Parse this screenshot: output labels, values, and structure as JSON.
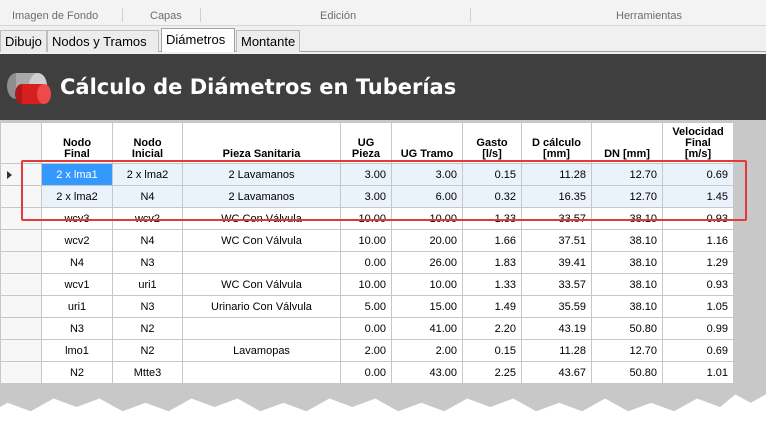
{
  "ribbon": {
    "groups": [
      "Imagen de Fondo",
      "Capas",
      "Edición",
      "Herramientas"
    ]
  },
  "tabs": [
    {
      "label": "Dibujo",
      "active": false
    },
    {
      "label": "Nodos y Tramos",
      "active": false
    },
    {
      "label": "Diámetros",
      "active": true
    },
    {
      "label": "Montante",
      "active": false
    }
  ],
  "header": {
    "title": "Cálculo de Diámetros en Tuberías",
    "icon": "pipe-icon",
    "colors": {
      "band": "#3f3f3f",
      "pipe_red": "#d62020",
      "pipe_gray": "#9a9a9a"
    }
  },
  "grid": {
    "columns": [
      [
        "Nodo",
        "Final"
      ],
      [
        "Nodo",
        "Inicial"
      ],
      [
        "Pieza Sanitaria"
      ],
      [
        "UG",
        "Pieza"
      ],
      [
        "UG Tramo"
      ],
      [
        "Gasto",
        "[l/s]"
      ],
      [
        "D cálculo",
        "[mm]"
      ],
      [
        "DN [mm]"
      ],
      [
        "Velocidad",
        "Final",
        "[m/s]"
      ]
    ],
    "rows": [
      [
        "2 x lma1",
        "2 x lma2",
        "2 Lavamanos",
        "3.00",
        "3.00",
        "0.15",
        "11.28",
        "12.70",
        "0.69"
      ],
      [
        "2 x lma2",
        "N4",
        "2 Lavamanos",
        "3.00",
        "6.00",
        "0.32",
        "16.35",
        "12.70",
        "1.45"
      ],
      [
        "wcv3",
        "wcv2",
        "WC Con Válvula",
        "10.00",
        "10.00",
        "1.33",
        "33.57",
        "38.10",
        "0.93"
      ],
      [
        "wcv2",
        "N4",
        "WC Con Válvula",
        "10.00",
        "20.00",
        "1.66",
        "37.51",
        "38.10",
        "1.16"
      ],
      [
        "N4",
        "N3",
        "",
        "0.00",
        "26.00",
        "1.83",
        "39.41",
        "38.10",
        "1.29"
      ],
      [
        "wcv1",
        "uri1",
        "WC Con Válvula",
        "10.00",
        "10.00",
        "1.33",
        "33.57",
        "38.10",
        "0.93"
      ],
      [
        "uri1",
        "N3",
        "Urinario Con Válvula",
        "5.00",
        "15.00",
        "1.49",
        "35.59",
        "38.10",
        "1.05"
      ],
      [
        "N3",
        "N2",
        "",
        "0.00",
        "41.00",
        "2.20",
        "43.19",
        "50.80",
        "0.99"
      ],
      [
        "lmo1",
        "N2",
        "Lavamopas",
        "2.00",
        "2.00",
        "0.15",
        "11.28",
        "12.70",
        "0.69"
      ],
      [
        "N2",
        "Mtte3",
        "",
        "0.00",
        "43.00",
        "2.25",
        "43.67",
        "50.80",
        "1.01"
      ]
    ],
    "selected_rows": [
      0,
      1
    ],
    "current_row": 0,
    "current_col": 0,
    "highlight_color": "#e23a3a"
  }
}
